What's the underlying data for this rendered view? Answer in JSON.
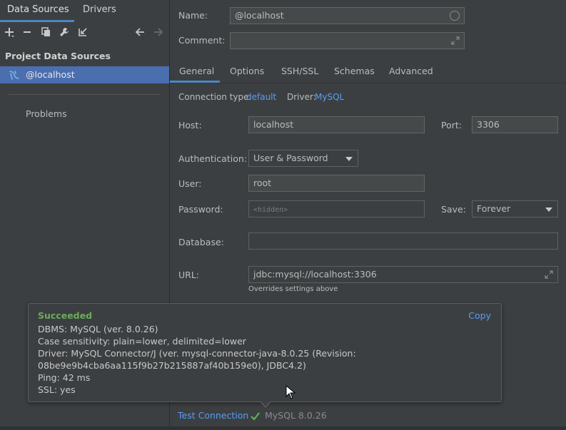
{
  "left": {
    "tabs": {
      "data_sources": "Data Sources",
      "drivers": "Drivers"
    },
    "toolbar": [
      "add-icon",
      "remove-icon",
      "duplicate-icon",
      "wrench-icon",
      "import-icon",
      "back-arrow-icon",
      "forward-arrow-icon"
    ],
    "section_title": "Project Data Sources",
    "selected_item": "@localhost",
    "problems": "Problems"
  },
  "form": {
    "name_label": "Name:",
    "name_value": "@localhost",
    "comment_label": "Comment:",
    "comment_value": "",
    "tabs": [
      "General",
      "Options",
      "SSH/SSL",
      "Schemas",
      "Advanced"
    ],
    "connection_type_label": "Connection type:",
    "connection_type_value": "default",
    "driver_label": "Driver:",
    "driver_value": "MySQL",
    "host_label": "Host:",
    "host_value": "localhost",
    "port_label": "Port:",
    "port_value": "3306",
    "auth_label": "Authentication:",
    "auth_value": "User & Password",
    "user_label": "User:",
    "user_value": "root",
    "password_label": "Password:",
    "password_placeholder": "<hidden>",
    "save_label": "Save:",
    "save_value": "Forever",
    "database_label": "Database:",
    "database_value": "",
    "url_label": "URL:",
    "url_value": "jdbc:mysql://localhost:3306",
    "url_hint": "Overrides settings above"
  },
  "popup": {
    "title": "Succeeded",
    "copy": "Copy",
    "lines": [
      "DBMS: MySQL (ver. 8.0.26)",
      "Case sensitivity: plain=lower, delimited=lower",
      "Driver: MySQL Connector/J (ver. mysql-connector-java-8.0.25 (Revision:",
      "08be9e9b4cba6aa115f9b27b215887af40b159e0), JDBC4.2)",
      "Ping: 42 ms",
      "SSL: yes"
    ]
  },
  "footer": {
    "test_connection": "Test Connection",
    "status": "MySQL 8.0.26"
  },
  "colors": {
    "accent": "#4a88c7",
    "link": "#589df6",
    "success": "#6aac5c",
    "selection": "#4b6eaf"
  }
}
